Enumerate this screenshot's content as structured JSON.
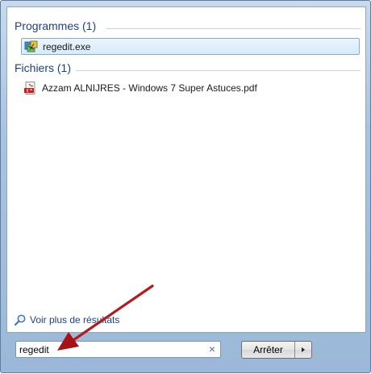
{
  "sections": {
    "programs": {
      "title": "Programmes (1)",
      "items": [
        {
          "label": "regedit.exe",
          "icon": "regedit-icon"
        }
      ]
    },
    "files": {
      "title": "Fichiers (1)",
      "items": [
        {
          "label": "Azzam ALNIJRES - Windows 7 Super Astuces.pdf",
          "icon": "pdf-icon"
        }
      ]
    }
  },
  "more_results": {
    "label": "Voir plus de résultats",
    "icon": "search-icon"
  },
  "search": {
    "value": "regedit",
    "clear_icon": "clear-icon"
  },
  "shutdown": {
    "label": "Arrêter",
    "menu_icon": "triangle-right-icon"
  },
  "annotation": {
    "color": "#c0171d"
  }
}
